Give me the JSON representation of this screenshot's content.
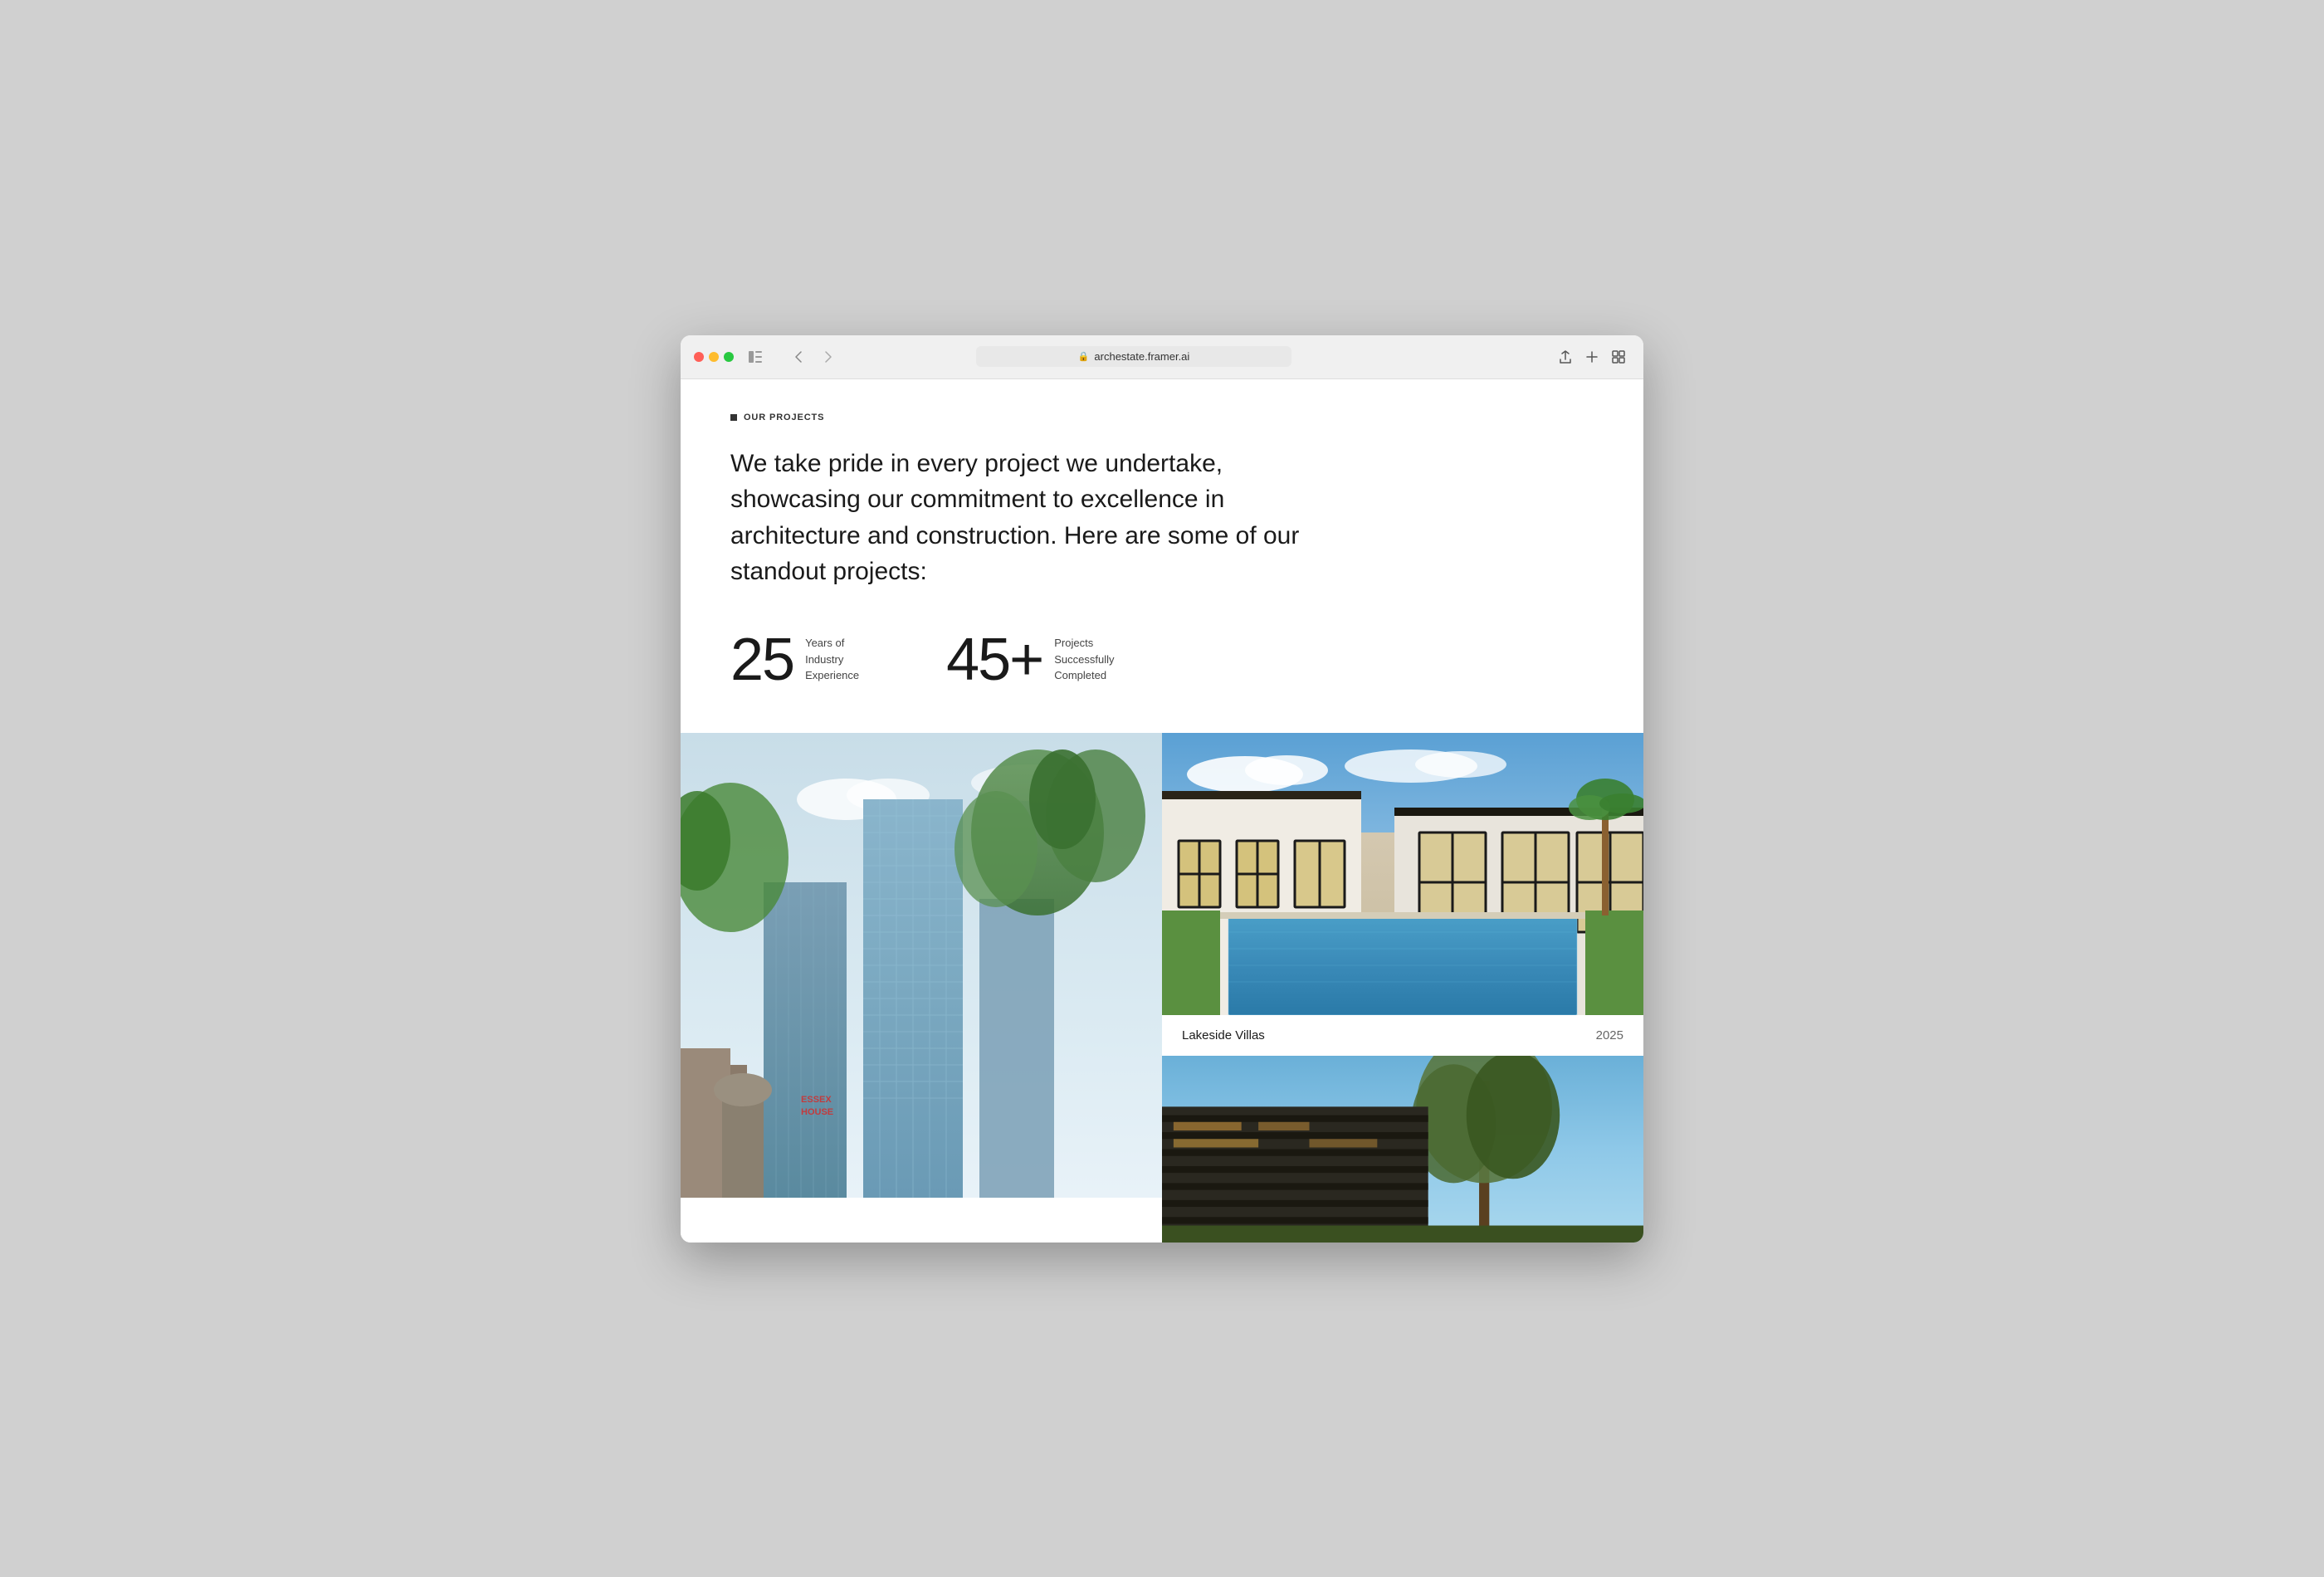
{
  "browser": {
    "url": "archestate.framer.ai",
    "more_button": "···"
  },
  "section": {
    "label": "OUR PROJECTS",
    "hero_text": "We take pride in every project we undertake, showcasing our commitment to excellence in architecture and construction. Here are some of our standout projects:",
    "stats": [
      {
        "number": "25",
        "label": "Years of Industry Experience"
      },
      {
        "number": "45+",
        "label": "Projects Successfully Completed"
      }
    ],
    "projects": [
      {
        "title": "Lakeside Villas",
        "year": "2025"
      }
    ]
  }
}
